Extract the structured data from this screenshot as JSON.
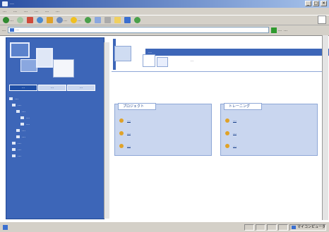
{
  "window": {
    "title": "…"
  },
  "menubar": {
    "items": [
      "…",
      "…",
      "…",
      "…",
      "…",
      "…"
    ]
  },
  "toolbar": {
    "back_label": "…",
    "search_label": "…",
    "favorites_label": "…"
  },
  "address": {
    "label": "…",
    "url": "…",
    "go_label": "…",
    "links_label": "…"
  },
  "leftpane": {
    "tabs": [
      "…",
      "…",
      "…"
    ],
    "tree": [
      "…",
      "…",
      "…",
      "…",
      "…",
      "…",
      "…",
      "…",
      "…",
      "…"
    ]
  },
  "section": {
    "title": "…",
    "description": "…"
  },
  "panels": [
    {
      "title": "プロジェクト",
      "links": [
        "…",
        "…",
        "…"
      ]
    },
    {
      "title": "トレーニング",
      "links": [
        "…",
        "…",
        "…"
      ]
    }
  ],
  "statusbar": {
    "zone": "マイコンピュータ"
  },
  "colors": {
    "accent": "#3d66b8",
    "panel": "#c9d6ef",
    "titlebar": "#2a4fa3"
  }
}
